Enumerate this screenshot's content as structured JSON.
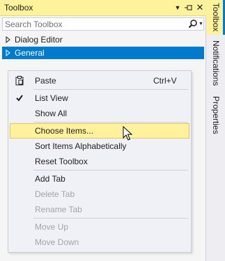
{
  "toolbox": {
    "title": "Toolbox",
    "title_buttons": {
      "dropdown_icon": "chevron-down-icon",
      "pin_icon": "pin-icon",
      "close_icon": "close-icon"
    },
    "search": {
      "placeholder": "Search Toolbox",
      "value": ""
    },
    "tree": [
      {
        "label": "Dialog Editor",
        "expanded": false,
        "selected": false
      },
      {
        "label": "General",
        "expanded": false,
        "selected": true
      }
    ]
  },
  "side_tabs": [
    {
      "label": "Toolbox",
      "active": true
    },
    {
      "label": "Notifications",
      "active": false
    },
    {
      "label": "Properties",
      "active": false
    }
  ],
  "context_menu": {
    "items": [
      {
        "label": "Paste",
        "shortcut": "Ctrl+V",
        "icon": "paste-icon",
        "enabled": true
      },
      {
        "label": "List View",
        "checked": true,
        "enabled": true
      },
      {
        "label": "Show All",
        "enabled": true
      },
      {
        "label": "Choose Items...",
        "enabled": true,
        "hovered": true
      },
      {
        "label": "Sort Items Alphabetically",
        "enabled": true
      },
      {
        "label": "Reset Toolbox",
        "enabled": true
      },
      {
        "label": "Add Tab",
        "enabled": true
      },
      {
        "label": "Delete Tab",
        "enabled": false
      },
      {
        "label": "Rename Tab",
        "enabled": false
      },
      {
        "label": "Move Up",
        "enabled": false
      },
      {
        "label": "Move Down",
        "enabled": false
      }
    ]
  },
  "colors": {
    "title_highlight": "#FFF29D",
    "selection": "#007ACC",
    "menu_bg": "#F0F0F7",
    "disabled_text": "#A2A4A5"
  }
}
